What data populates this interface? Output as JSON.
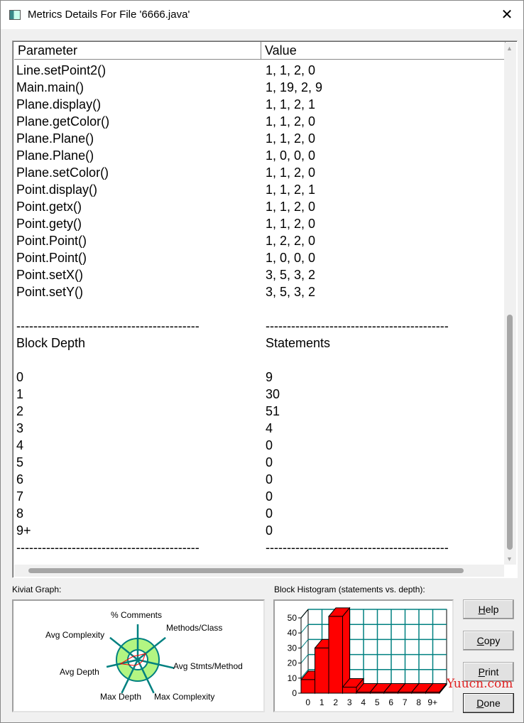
{
  "window": {
    "title": "Metrics Details For File '6666.java'",
    "close_icon": "close-icon"
  },
  "table": {
    "headers": [
      "Parameter",
      "Value"
    ],
    "rows": [
      [
        "Line.setPoint2()",
        "1, 1, 2, 0"
      ],
      [
        "Main.main()",
        "1, 19, 2, 9"
      ],
      [
        "Plane.display()",
        "1, 1, 2, 1"
      ],
      [
        "Plane.getColor()",
        "1, 1, 2, 0"
      ],
      [
        "Plane.Plane()",
        "1, 1, 2, 0"
      ],
      [
        "Plane.Plane()",
        "1, 0, 0, 0"
      ],
      [
        "Plane.setColor()",
        "1, 1, 2, 0"
      ],
      [
        "Point.display()",
        "1, 1, 2, 1"
      ],
      [
        "Point.getx()",
        "1, 1, 2, 0"
      ],
      [
        "Point.gety()",
        "1, 1, 2, 0"
      ],
      [
        "Point.Point()",
        "1, 2, 2, 0"
      ],
      [
        "Point.Point()",
        "1, 0, 0, 0"
      ],
      [
        "Point.setX()",
        "3, 5, 3, 2"
      ],
      [
        "Point.setY()",
        "3, 5, 3, 2"
      ],
      [
        "",
        ""
      ],
      [
        "-------------------------------------------",
        "-------------------------------------------"
      ],
      [
        "Block Depth",
        "Statements"
      ],
      [
        "",
        ""
      ],
      [
        "0",
        "9"
      ],
      [
        "1",
        "30"
      ],
      [
        "2",
        "51"
      ],
      [
        "3",
        "4"
      ],
      [
        "4",
        "0"
      ],
      [
        "5",
        "0"
      ],
      [
        "6",
        "0"
      ],
      [
        "7",
        "0"
      ],
      [
        "8",
        "0"
      ],
      [
        "9+",
        "0"
      ],
      [
        "-------------------------------------------",
        "-------------------------------------------"
      ]
    ]
  },
  "kiviat": {
    "label": "Kiviat Graph:",
    "axes": [
      "% Comments",
      "Methods/Class",
      "Avg Stmts/Method",
      "Max Complexity",
      "Max Depth",
      "Avg Depth",
      "Avg Complexity"
    ],
    "ring_color": "#b3f582",
    "axis_color": "#008080",
    "line_color": "#ff0000"
  },
  "histogram": {
    "label": "Block Histogram (statements vs. depth):"
  },
  "chart_data": {
    "type": "bar",
    "categories": [
      "0",
      "1",
      "2",
      "3",
      "4",
      "5",
      "6",
      "7",
      "8",
      "9+"
    ],
    "values": [
      9,
      30,
      51,
      4,
      0,
      0,
      0,
      0,
      0,
      0
    ],
    "yticks": [
      0,
      10,
      20,
      30,
      40,
      50
    ],
    "ylim": [
      0,
      50
    ],
    "grid": true,
    "bar_color": "#ff0000",
    "grid_color": "#008080",
    "style": "3d"
  },
  "buttons": {
    "help": {
      "k": "H",
      "r": "elp"
    },
    "copy": {
      "k": "C",
      "r": "opy"
    },
    "print": {
      "k": "P",
      "r": "rint"
    },
    "done": {
      "k": "D",
      "r": "one"
    }
  },
  "watermark": "Yuucn.com"
}
